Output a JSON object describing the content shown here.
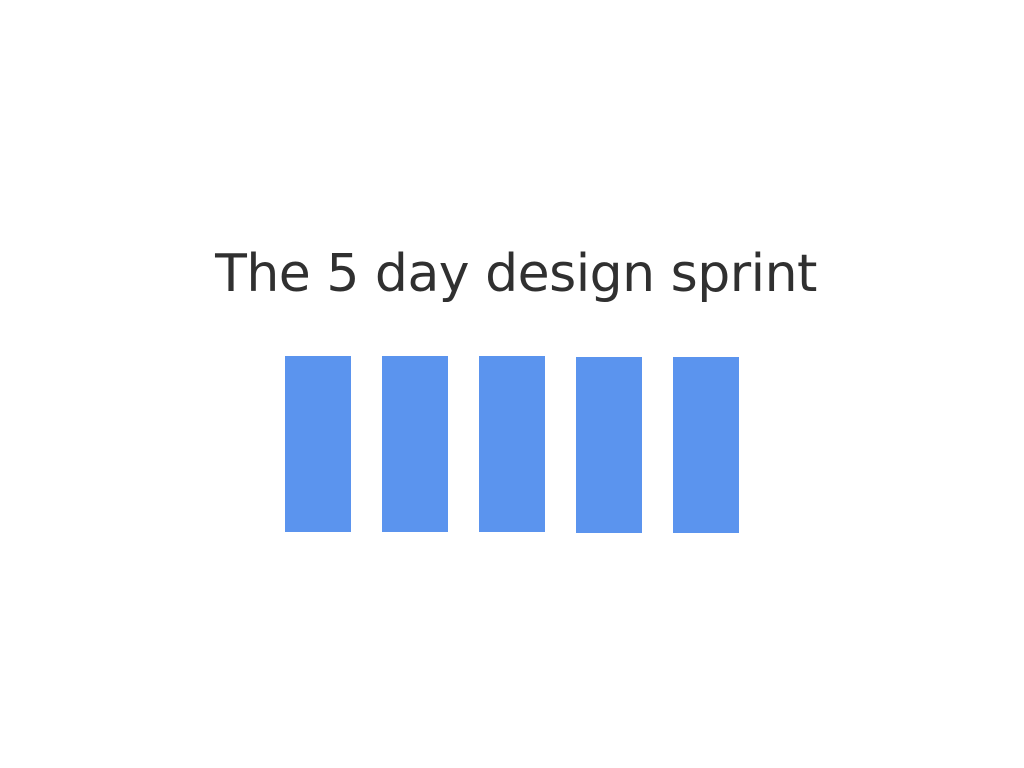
{
  "slide": {
    "title": "The 5 day design sprint"
  },
  "blocks": {
    "count": 5,
    "color": "#5b94ee"
  },
  "colors": {
    "background": "#ffffff",
    "title_text": "#303030",
    "block_fill": "#5b94ee"
  }
}
